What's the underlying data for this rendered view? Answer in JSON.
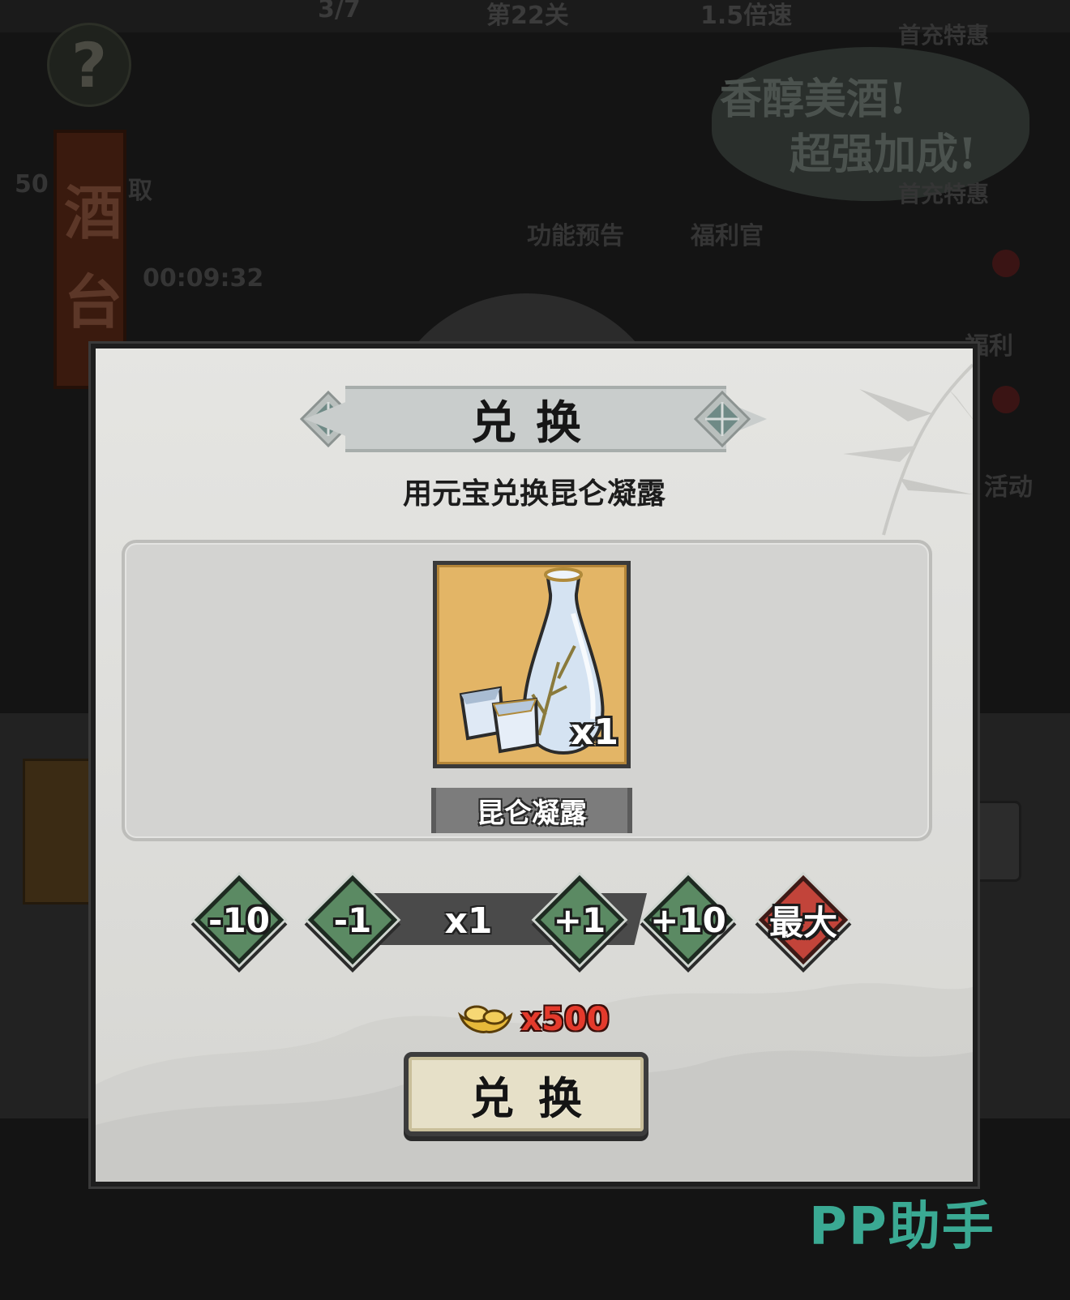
{
  "background": {
    "top_texts": [
      "3/7",
      "第22关",
      "1.5倍速"
    ],
    "help_symbol": "?",
    "banner_chars": [
      "酒",
      "台"
    ],
    "left_label": "50",
    "left_label_suffix": "取",
    "timer": "00:09:32",
    "bubble_line1": "香醇美酒!",
    "bubble_line2": "超强加成!",
    "promo_top": "首充特惠",
    "promo_bottom": "首充特惠",
    "menu_function_preview": "功能预告",
    "menu_welfare": "福利官",
    "menu_welfare2": "福利",
    "menu_activity": "活动"
  },
  "dialog": {
    "title": "兑换",
    "subtitle": "用元宝兑换昆仑凝露",
    "item": {
      "name": "昆仑凝露",
      "quantity_badge": "x1",
      "icon": "wine-bottle-icon"
    },
    "stepper": {
      "minus10": "-10",
      "minus1": "-1",
      "current": "x1",
      "plus1": "+1",
      "plus10": "+10",
      "max": "最大"
    },
    "cost": {
      "currency_icon": "gold-ingot-icon",
      "amount": "x500"
    },
    "confirm_label": "兑换"
  },
  "watermark": "PP助手",
  "colors": {
    "stepper_green": "#5b8a63",
    "max_red": "#c2443a",
    "cost_red": "#e43a2c",
    "item_bg": "#e3b566",
    "watermark": "#3aa993"
  }
}
